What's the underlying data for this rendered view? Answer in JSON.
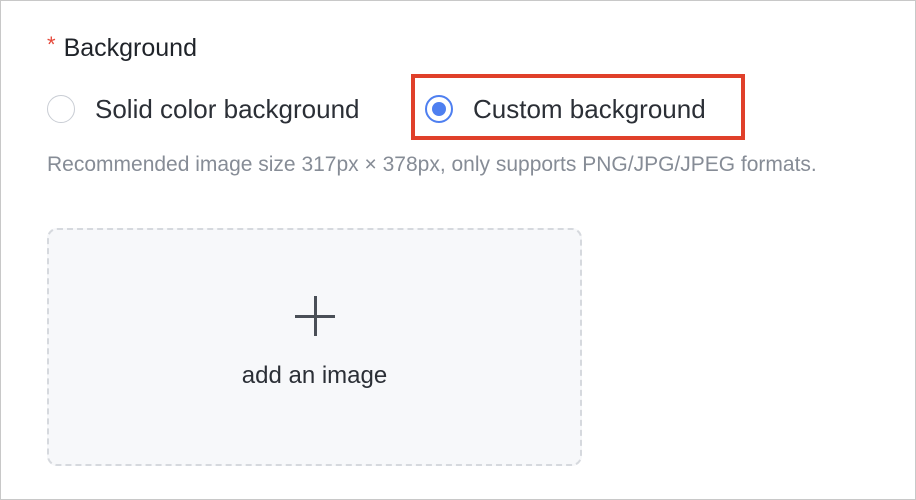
{
  "field": {
    "required_mark": "*",
    "label": "Background"
  },
  "options": [
    {
      "label": "Solid color background",
      "selected": false
    },
    {
      "label": "Custom background",
      "selected": true
    }
  ],
  "hint": "Recommended image size 317px × 378px, only supports PNG/JPG/JPEG formats.",
  "upload": {
    "icon": "plus-icon",
    "label": "add an image"
  },
  "colors": {
    "accent": "#4e7ff0",
    "required": "#e5483a",
    "highlight": "#e0402a",
    "hint_text": "#868c96"
  }
}
